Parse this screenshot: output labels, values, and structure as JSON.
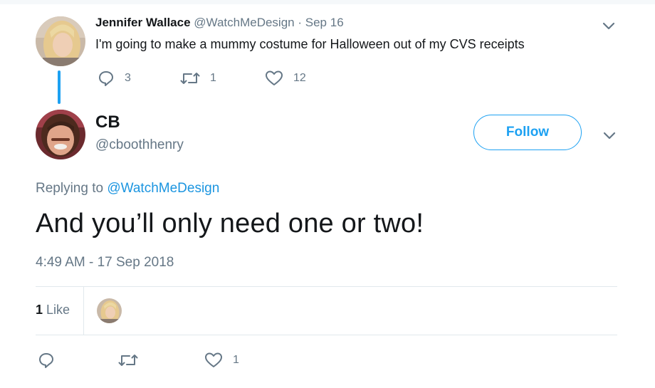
{
  "parent_tweet": {
    "author_name": "Jennifer Wallace",
    "author_handle": "@WatchMeDesign",
    "separator": "·",
    "date": "Sep 16",
    "text": "I'm going to make a mummy costume for Halloween out of my CVS receipts",
    "reply_count": "3",
    "retweet_count": "1",
    "like_count": "12"
  },
  "main_tweet": {
    "author_name": "CB",
    "author_handle": "@cboothhenry",
    "follow_label": "Follow",
    "replying_prefix": "Replying to",
    "replying_mention": "@WatchMeDesign",
    "text": "And you’ll only need one or two!",
    "timestamp": "4:49 AM - 17 Sep 2018",
    "likes_count": "1",
    "likes_label": "Like",
    "action_like_count": "1"
  },
  "icons": {
    "reply": "reply-icon",
    "retweet": "retweet-icon",
    "like": "heart-icon",
    "more": "chevron-down-icon"
  },
  "colors": {
    "accent": "#1da1f2",
    "mention": "#1b95e0",
    "muted": "#657786",
    "text": "#14171a",
    "divider": "#e1e8ed"
  }
}
